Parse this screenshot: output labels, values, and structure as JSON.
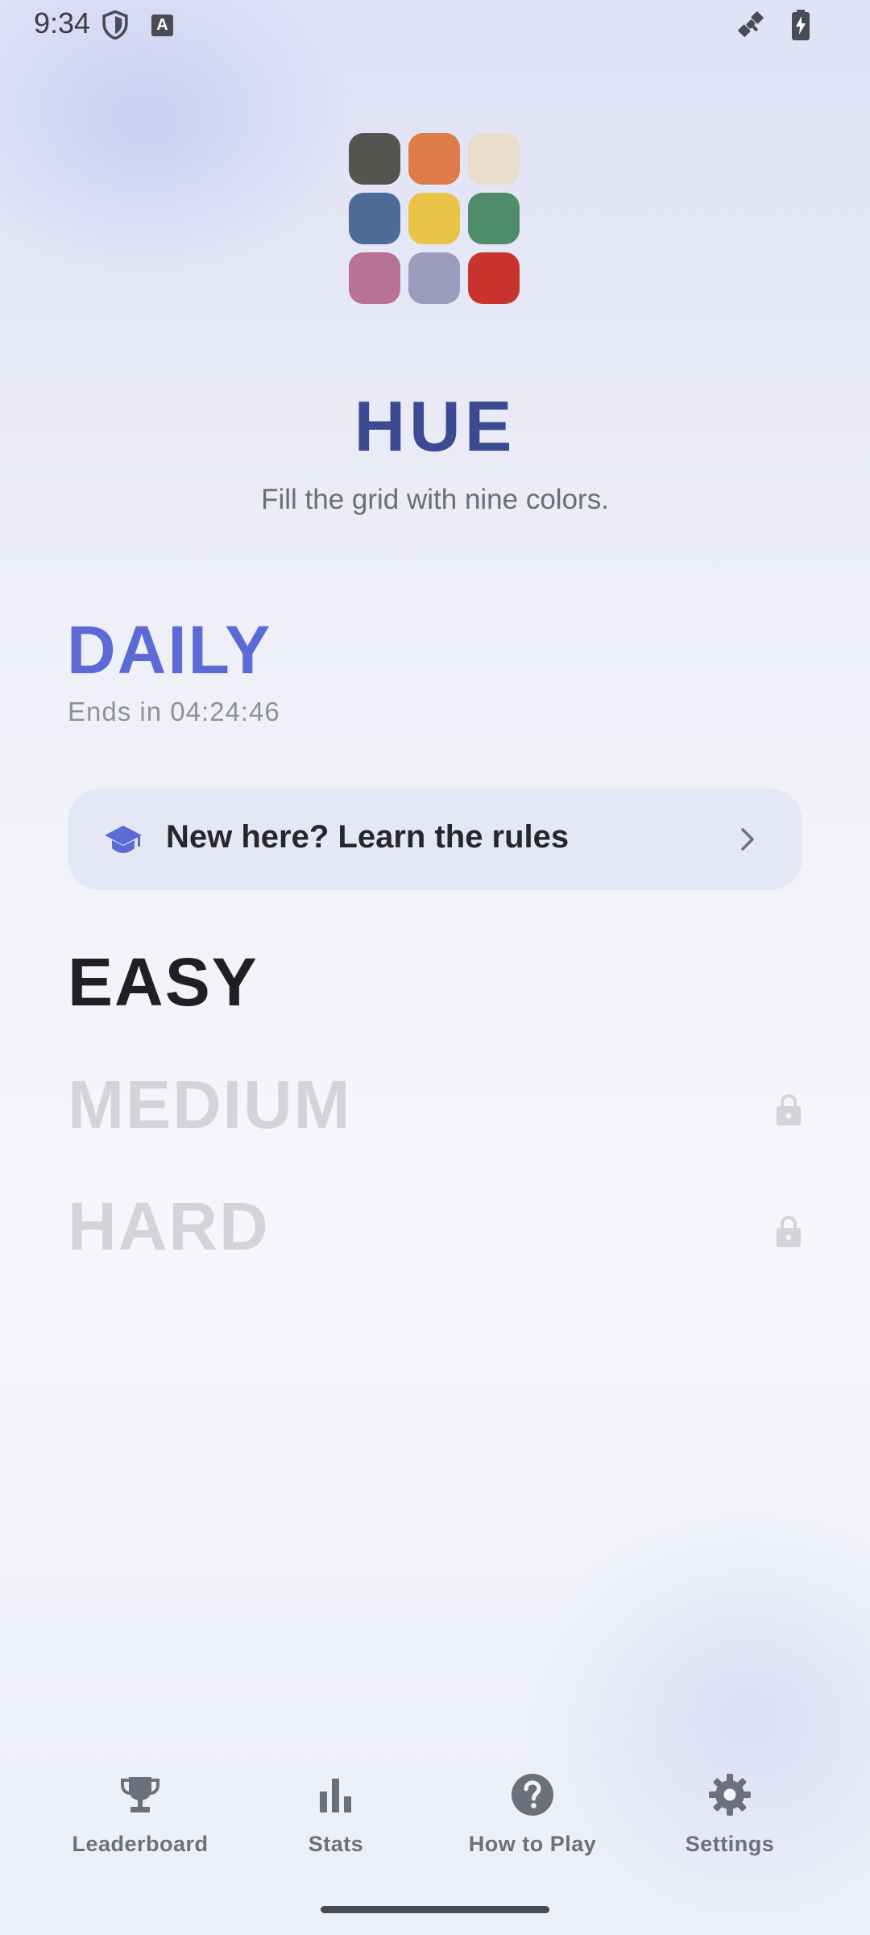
{
  "status_bar": {
    "time": "9:34",
    "icons": [
      "shield-icon",
      "keyboard-a-icon",
      "satellite-icon",
      "battery-charging-icon"
    ]
  },
  "logo": {
    "colors": [
      "#545550",
      "#de7c48",
      "#e8dccb",
      "#4e6b98",
      "#e9c449",
      "#4f8c6b",
      "#b87394",
      "#9a9bbd",
      "#c8342d"
    ]
  },
  "header": {
    "title": "HUE",
    "subtitle": "Fill the grid with nine colors."
  },
  "daily": {
    "title": "DAILY",
    "timer": "Ends in 04:24:46"
  },
  "rules_banner": {
    "label": "New here? Learn the rules",
    "icon": "graduation-cap-icon",
    "chevron": "chevron-right-icon"
  },
  "levels": [
    {
      "label": "EASY",
      "locked": false
    },
    {
      "label": "MEDIUM",
      "locked": true
    },
    {
      "label": "HARD",
      "locked": true
    }
  ],
  "bottom_nav": {
    "items": [
      {
        "label": "Leaderboard",
        "icon": "trophy-icon"
      },
      {
        "label": "Stats",
        "icon": "bar-chart-icon"
      },
      {
        "label": "How to Play",
        "icon": "help-circle-icon"
      },
      {
        "label": "Settings",
        "icon": "gear-icon"
      }
    ]
  },
  "theme": {
    "accent": "#5b6ad4",
    "title_color": "#3c4a92"
  }
}
